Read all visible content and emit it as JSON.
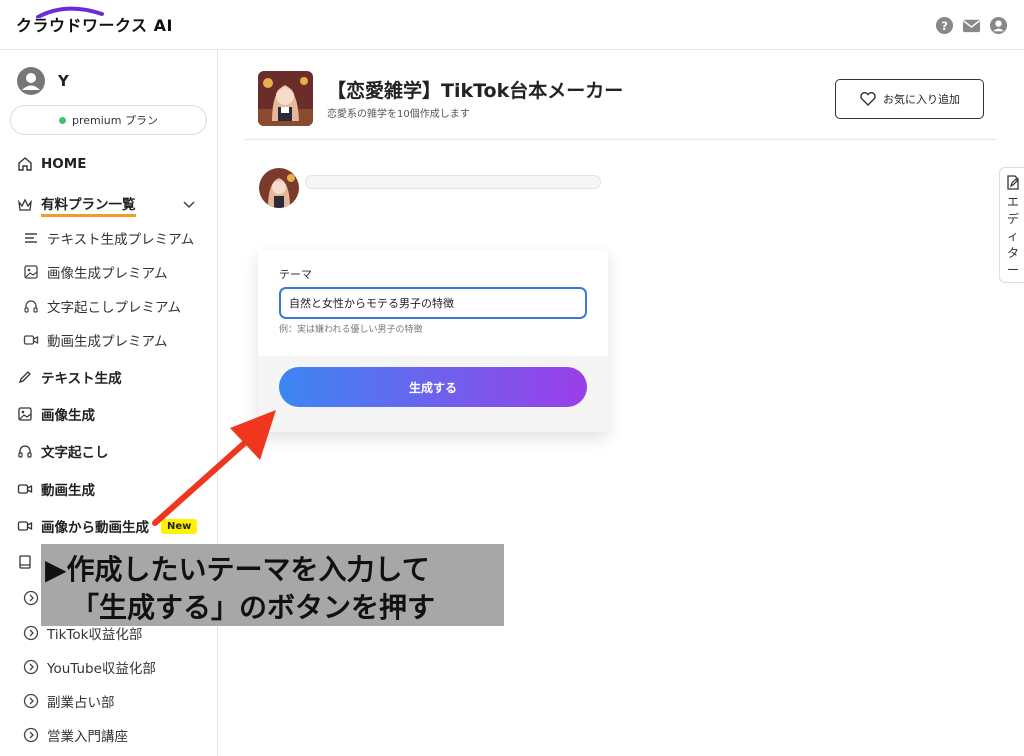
{
  "header": {
    "logo_text": "クラウドワークス AI",
    "icons": [
      "help-icon",
      "mail-icon",
      "account-icon"
    ]
  },
  "sidebar": {
    "user_name": "Y",
    "plan_label": "premium プラン",
    "nav": {
      "home": "HOME",
      "paid_plans": "有料プラン一覧",
      "paid_sub": [
        "テキスト生成プレミアム",
        "画像生成プレミアム",
        "文字起こしプレミアム",
        "動画生成プレミアム"
      ],
      "text_gen": "テキスト生成",
      "image_gen": "画像生成",
      "transcribe": "文字起こし",
      "video_gen": "動画生成",
      "image_to_video": "画像から動画生成",
      "new_badge": "New",
      "courses": [
        "TikTok収益化部",
        "YouTube収益化部",
        "副業占い部",
        "営業入門講座"
      ]
    }
  },
  "tool": {
    "title": "【恋愛雑学】TikTok台本メーカー",
    "description": "恋愛系の雑学を10個作成します",
    "favorite_label": "お気に入り追加"
  },
  "editor_tab": {
    "label": "エディター"
  },
  "form": {
    "field_label": "テーマ",
    "field_value": "自然と女性からモテる男子の特徴",
    "hint": "例：実は嫌われる優しい男子の特徴",
    "submit_label": "生成する"
  },
  "annotation": {
    "line1": "▶作成したいテーマを入力して",
    "line2": "「生成する」のボタンを押す",
    "arrow_color": "#f0361f"
  },
  "colors": {
    "accent_blue": "#3d86f2",
    "accent_purple": "#9a3fe8",
    "underline_orange": "#f39a2a",
    "premium_dot": "#3cc46b"
  }
}
